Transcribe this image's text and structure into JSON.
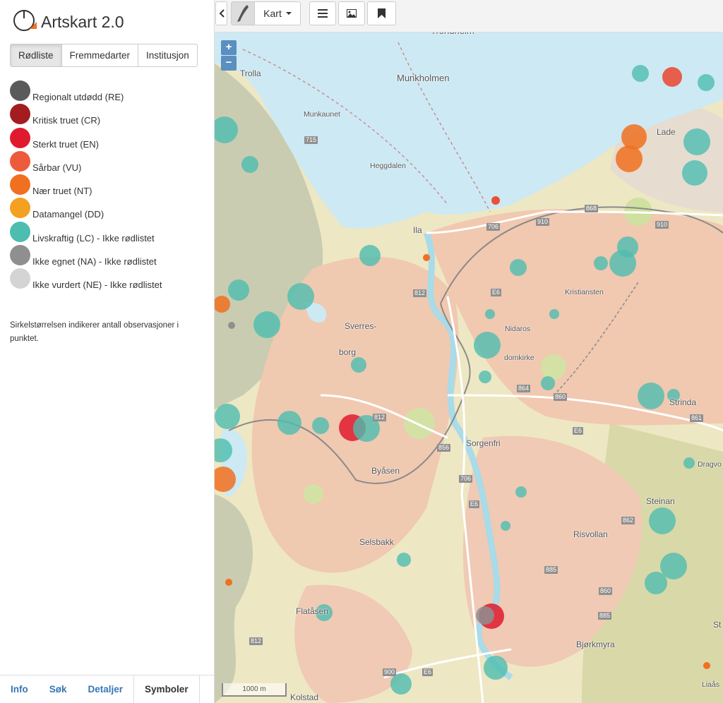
{
  "app": {
    "title": "Artskart 2.0"
  },
  "tabs": [
    {
      "label": "Rødliste",
      "active": true
    },
    {
      "label": "Fremmedarter",
      "active": false
    },
    {
      "label": "Institusjon",
      "active": false
    }
  ],
  "legend": [
    {
      "label": "Regionalt utdødd (RE)",
      "color": "#5a5a5a"
    },
    {
      "label": "Kritisk truet (CR)",
      "color": "#a31d20"
    },
    {
      "label": "Sterkt truet (EN)",
      "color": "#e01a2e"
    },
    {
      "label": "Sårbar (VU)",
      "color": "#ee5a3c"
    },
    {
      "label": "Nær truet (NT)",
      "color": "#f07020"
    },
    {
      "label": "Datamangel (DD)",
      "color": "#f4a020"
    },
    {
      "label": "Livskraftig (LC) - Ikke rødlistet",
      "color": "#4dbdb0"
    },
    {
      "label": "Ikke egnet (NA) - Ikke rødlistet",
      "color": "#8f8f8f"
    },
    {
      "label": "Ikke vurdert (NE) - Ikke rødlistet",
      "color": "#d4d4d4"
    }
  ],
  "note": "Sirkelstørrelsen indikerer antall observasjoner i punktet.",
  "bottom_tabs": [
    {
      "label": "Info",
      "active": false
    },
    {
      "label": "Søk",
      "active": false
    },
    {
      "label": "Detaljer",
      "active": false
    },
    {
      "label": "Symboler",
      "active": true
    }
  ],
  "toolbar": {
    "basemap_label": "Kart",
    "icons": [
      "chevron-left-icon",
      "norway-map-thumbnail-icon",
      "list-icon",
      "image-icon",
      "bookmark-icon"
    ]
  },
  "map": {
    "zoom_in": "+",
    "zoom_out": "−",
    "scale": "1000 m",
    "places": [
      "Trondheim",
      "Munkholmen",
      "Trolla",
      "Munkaunet",
      "Heggdalen",
      "Ila",
      "Lade",
      "Kristiansten",
      "Nidaros",
      "domkirke",
      "Sverres-",
      "borg",
      "Strinda",
      "Sorgenfri",
      "Byåsen",
      "Steinan",
      "Dragvo",
      "Risvollan",
      "Selsbakk",
      "Flatåsen",
      "Bjørkmyra",
      "Kolstad",
      "Liaås",
      "St"
    ],
    "road_numbers": [
      "715",
      "868",
      "910",
      "910",
      "706",
      "812",
      "E6",
      "812",
      "856",
      "864",
      "860",
      "E6",
      "861",
      "706",
      "E6",
      "862",
      "885",
      "860",
      "885",
      "812",
      "900",
      "E6"
    ]
  },
  "observations": [
    {
      "lat_idx": 1,
      "status": "LC"
    }
  ]
}
